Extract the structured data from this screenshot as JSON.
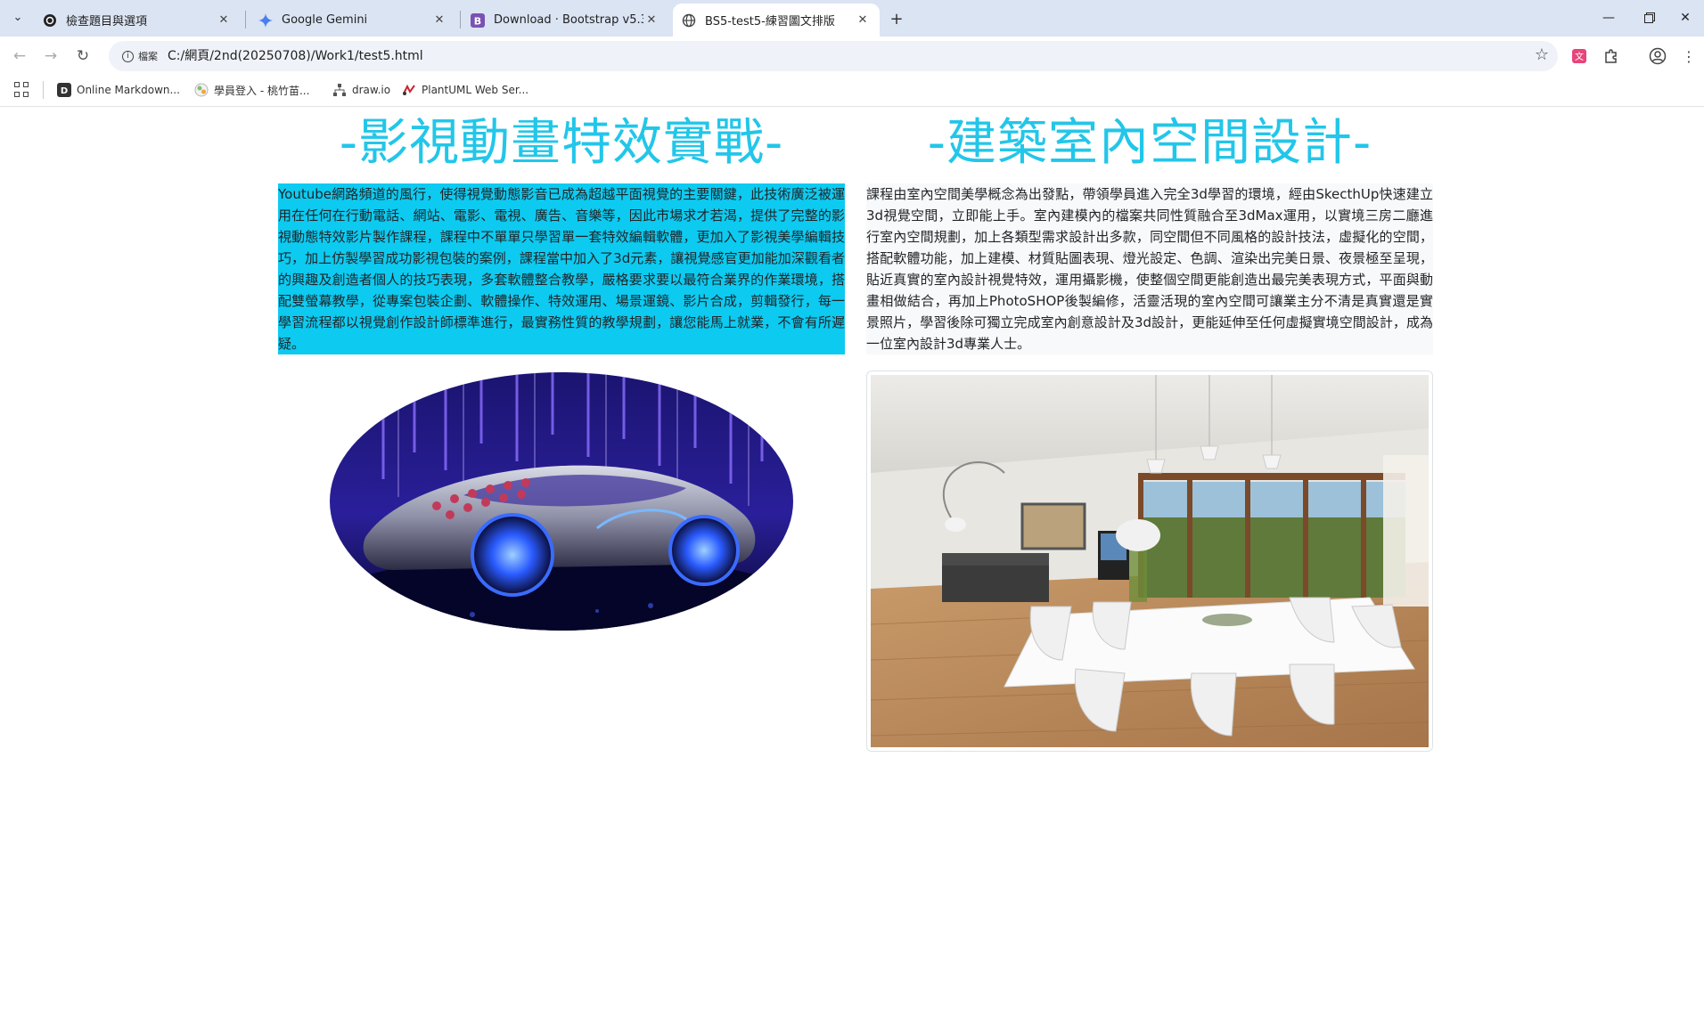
{
  "browser": {
    "tabs": [
      {
        "title": "檢查題目與選項",
        "icon": "chatgpt-icon"
      },
      {
        "title": "Google Gemini",
        "icon": "gemini-icon"
      },
      {
        "title": "Download · Bootstrap v5.3",
        "icon": "bootstrap-icon"
      },
      {
        "title": "BS5-test5-練習圖文排版",
        "icon": "globe-icon",
        "active": true
      }
    ],
    "address": {
      "chip": "檔案",
      "url": "C:/網頁/2nd(20250708)/Work1/test5.html"
    },
    "bookmarks": [
      {
        "label": "Online Markdown..."
      },
      {
        "label": "學員登入 - 桃竹苗..."
      },
      {
        "label": "draw.io"
      },
      {
        "label": "PlantUML Web Ser..."
      }
    ]
  },
  "content": {
    "left": {
      "heading": "-影視動畫特效實戰-",
      "paragraph": "Youtube網路頻道的風行，使得視覺動態影音已成為超越平面視覺的主要關鍵，此技術廣泛被運用在任何在行動電話、網站、電影、電視、廣告、音樂等，因此市場求才若渴，提供了完整的影視動態特效影片製作課程，課程中不單單只學習單一套特效編輯軟體，更加入了影視美學編輯技巧，加上仿製學習成功影視包裝的案例，課程當中加入了3d元素，讓視覺感官更加能加深觀看者的興趣及創造者個人的技巧表現，多套軟體整合教學，嚴格要求要以最符合業界的作業環境，搭配雙螢幕教學，從專案包裝企劃、軟體操作、特效運用、場景運鏡、影片合成，剪輯發行，每一學習流程都以視覺創作設計師標準進行，最實務性質的教學規劃，讓您能馬上就業，不會有所遲疑。",
      "highlight_color": "#0dcaf0"
    },
    "right": {
      "heading": "-建築室內空間設計-",
      "paragraph": "課程由室內空間美學概念為出發點，帶領學員進入完全3d學習的環境，經由SkecthUp快速建立3d視覺空間，立即能上手。室內建模內的檔案共同性質融合至3dMax運用，以實境三房二廳進行室內空間規劃，加上各類型需求設計出多款，同空間但不同風格的設計技法，虛擬化的空間，搭配軟體功能，加上建模、材質貼圖表現、燈光設定、色調、渲染出完美日景、夜景極至呈現，貼近真實的室內設計視覺特效，運用攝影機，使整個空間更能創造出最完美表現方式，平面與動畫相做結合，再加上PhotoSHOP後製編修，活靈活現的室內空間可讓業主分不清是真實還是實景照片，學習後除可獨立完成室內創意設計及3d設計，更能延伸至任何虛擬實境空間設計，成為一位室內設計3d專業人士。",
      "background_color": "#f8f9fa"
    },
    "heading_color": "#22c6e9"
  }
}
